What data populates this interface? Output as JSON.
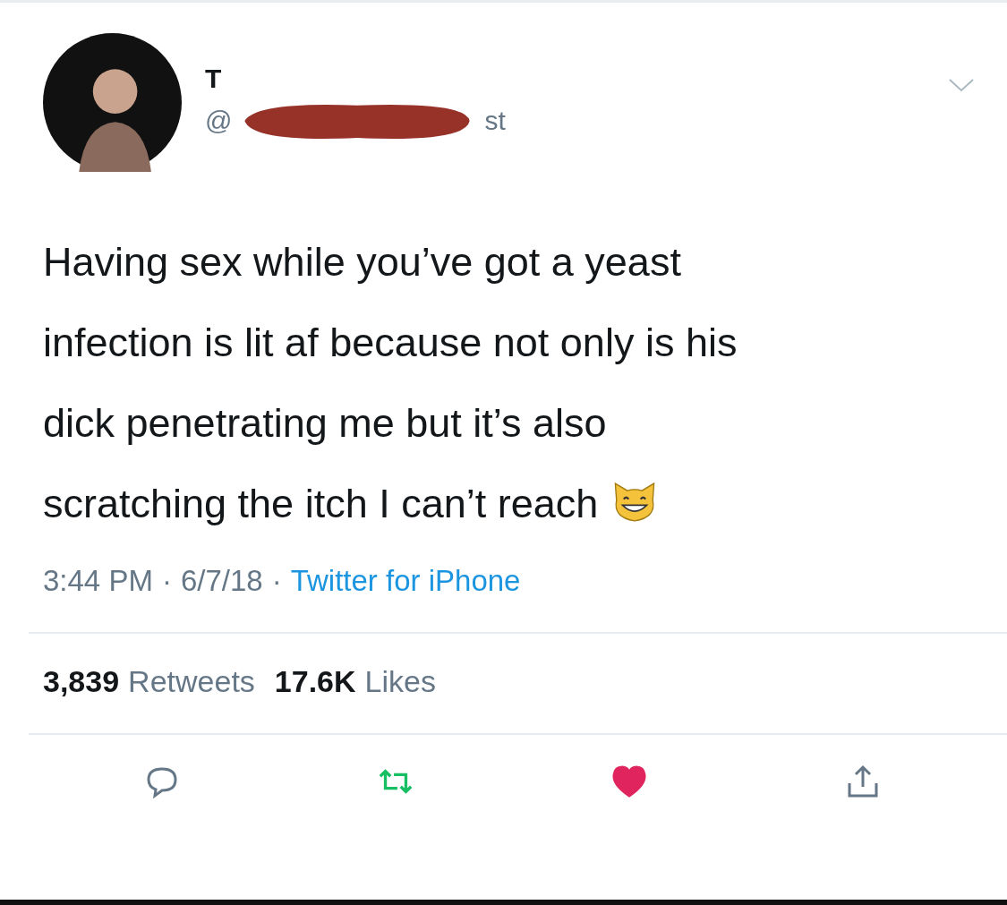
{
  "tweet": {
    "author": {
      "name": "T",
      "handle_start": "@",
      "handle_end": "st",
      "handle_redacted": true
    },
    "text_lines": [
      "Having sex while you’ve got a yeast",
      "infection is lit af because not only is his",
      "dick penetrating me but it’s also",
      "scratching the itch I can’t reach"
    ],
    "time": "3:44 PM",
    "separator_1": "·",
    "date": "6/7/18",
    "separator_2": "·",
    "source": "Twitter for iPhone",
    "stats": [
      {
        "count": "3,839",
        "label": "Retweets"
      },
      {
        "count": "17.6K",
        "label": "Likes"
      }
    ],
    "actions": {
      "retweeted": true,
      "liked": true
    }
  }
}
